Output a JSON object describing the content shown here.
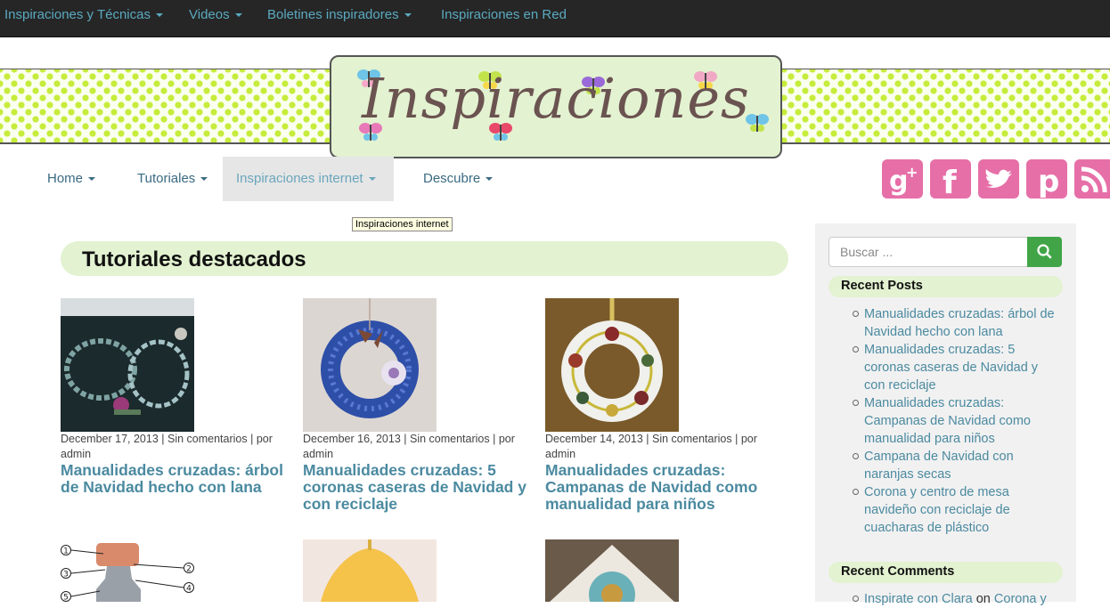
{
  "top_nav": [
    {
      "label": "Inspiraciones y Técnicas"
    },
    {
      "label": "Videos"
    },
    {
      "label": "Boletines inspiradores"
    },
    {
      "label": "Inspiraciones en Red"
    }
  ],
  "logo": {
    "text": "Inspiraciones"
  },
  "main_nav": [
    {
      "label": "Home"
    },
    {
      "label": "Tutoriales"
    },
    {
      "label": "Inspiraciones internet"
    },
    {
      "label": "Descubre"
    }
  ],
  "tooltip": "Inspiraciones internet",
  "social": [
    "google-plus-icon",
    "facebook-icon",
    "twitter-icon",
    "pinterest-icon",
    "rss-icon"
  ],
  "section_title": "Tutoriales destacados",
  "posts": [
    {
      "date": "December 17, 2013",
      "comments": "Sin comentarios",
      "by": "por",
      "author": "admin",
      "title": "Manualidades cruzadas: árbol de Navidad hecho con lana"
    },
    {
      "date": "December 16, 2013",
      "comments": "Sin comentarios",
      "by": "por",
      "author": "admin",
      "title": "Manualidades cruzadas: 5 coronas caseras de Navidad y con reciclaje"
    },
    {
      "date": "December 14, 2013",
      "comments": "Sin comentarios",
      "by": "por",
      "author": "admin",
      "title": "Manualidades cruzadas: Campanas de Navidad como manualidad para niños"
    }
  ],
  "diagram_numbers": [
    "1",
    "2",
    "3",
    "4",
    "5"
  ],
  "sidebar": {
    "search_placeholder": "Buscar ...",
    "recent_posts_title": "Recent Posts",
    "recent_posts": [
      "Manualidades cruzadas: árbol de Navidad hecho con lana",
      "Manualidades cruzadas: 5 coronas caseras de Navidad y con reciclaje",
      "Manualidades cruzadas: Campanas de Navidad como manualidad para niños",
      "Campana de Navidad con naranjas secas",
      "Corona y centro de mesa navideño con reciclaje de cuacharas de plástico"
    ],
    "recent_comments_title": "Recent Comments",
    "recent_comment": {
      "author": "Inspirate con Clara",
      "on": "on",
      "post": "Corona y"
    }
  },
  "colors": {
    "link": "#4b8aa0",
    "accent_green": "#e3f2d1",
    "pink": "#e66fa8",
    "search_green": "#41a547"
  }
}
